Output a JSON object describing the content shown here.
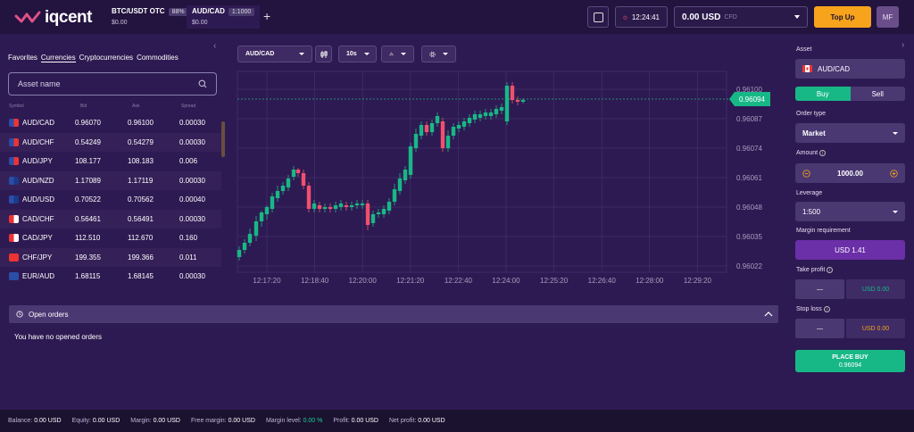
{
  "brand": {
    "name": "iqcent"
  },
  "header": {
    "tabs": [
      {
        "name": "BTC/USDT OTC",
        "badge": "88%",
        "price": "$0.00"
      },
      {
        "name": "AUD/CAD",
        "badge": "1:1000",
        "price": "$0.00"
      }
    ],
    "time": "12:24:41",
    "balance": "0.00 USD",
    "balance_type": "CFD",
    "topup_label": "Top Up",
    "avatar_initials": "MF"
  },
  "left": {
    "categories": [
      "Favorites",
      "Currencies",
      "Cryptocurrencies",
      "Commodities"
    ],
    "search_placeholder": "Asset name",
    "columns": [
      "Symbol",
      "Bid",
      "Ask",
      "Spread"
    ],
    "rows": [
      {
        "symbol": "AUD/CAD",
        "bid": "0.96070",
        "ask": "0.96100",
        "spread": "0.00030"
      },
      {
        "symbol": "AUD/CHF",
        "bid": "0.54249",
        "ask": "0.54279",
        "spread": "0.00030"
      },
      {
        "symbol": "AUD/JPY",
        "bid": "108.177",
        "ask": "108.183",
        "spread": "0.006"
      },
      {
        "symbol": "AUD/NZD",
        "bid": "1.17089",
        "ask": "1.17119",
        "spread": "0.00030"
      },
      {
        "symbol": "AUD/USD",
        "bid": "0.70522",
        "ask": "0.70562",
        "spread": "0.00040"
      },
      {
        "symbol": "CAD/CHF",
        "bid": "0.56461",
        "ask": "0.56491",
        "spread": "0.00030"
      },
      {
        "symbol": "CAD/JPY",
        "bid": "112.510",
        "ask": "112.670",
        "spread": "0.160"
      },
      {
        "symbol": "CHF/JPY",
        "bid": "199.355",
        "ask": "199.366",
        "spread": "0.011"
      },
      {
        "symbol": "EUR/AUD",
        "bid": "1.68115",
        "ask": "1.68145",
        "spread": "0.00030"
      }
    ]
  },
  "chart_toolbar": {
    "asset": "AUD/CAD",
    "interval": "10s"
  },
  "chart": {
    "current_price": "0.96094",
    "y_ticks": [
      "0.96100",
      "0.96087",
      "0.96074",
      "0.96061",
      "0.96048",
      "0.96035",
      "0.96022"
    ],
    "x_ticks": [
      "12:17:20",
      "12:18:40",
      "12:20:00",
      "12:21:20",
      "12:22:40",
      "12:24:00",
      "12:25:20",
      "12:26:40",
      "12:28:00",
      "12:29:20"
    ]
  },
  "orders": {
    "title": "Open orders",
    "empty": "You have no opened orders"
  },
  "order_form": {
    "asset_label": "Asset",
    "asset": "AUD/CAD",
    "buy": "Buy",
    "sell": "Sell",
    "order_type_label": "Order type",
    "order_type": "Market",
    "amount_label": "Amount",
    "amount": "1000.00",
    "leverage_label": "Leverage",
    "leverage": "1:500",
    "margin_label": "Margin requirement",
    "margin": "USD 1.41",
    "take_profit_label": "Take profit",
    "take_profit_dash": "—",
    "take_profit_value": "USD 0.00",
    "stop_loss_label": "Stop loss",
    "stop_loss_dash": "—",
    "stop_loss_value": "USD 0.00",
    "place_label": "PLACE BUY",
    "place_price": "0.96094"
  },
  "footer": {
    "balance_label": "Balance:",
    "balance": "0.00 USD",
    "equity_label": "Equity:",
    "equity": "0.00 USD",
    "margin_label": "Margin:",
    "margin": "0.00 USD",
    "free_margin_label": "Free margin:",
    "free_margin": "0.00 USD",
    "margin_level_label": "Margin level:",
    "margin_level": "0.00 %",
    "profit_label": "Profit:",
    "profit": "0.00 USD",
    "net_profit_label": "Net profit:",
    "net_profit": "0.00 USD"
  },
  "colors": {
    "accent": "#18b886",
    "topup": "#f7a31c",
    "down": "#f0506e",
    "up": "#18b886",
    "bg": "#2e1a52"
  }
}
